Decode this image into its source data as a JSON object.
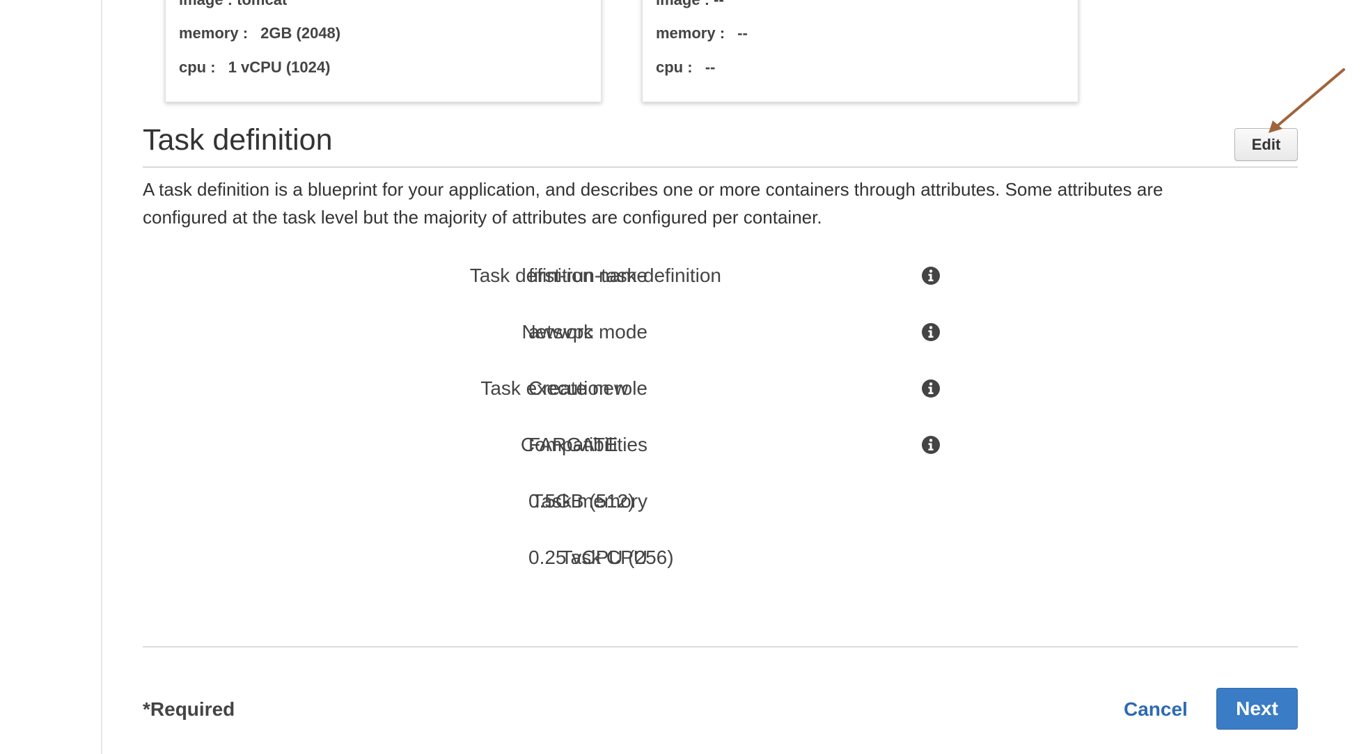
{
  "container_cards": [
    {
      "image_label": "image :",
      "image_value": "tomcat",
      "memory_label": "memory :",
      "memory_value": "2GB (2048)",
      "cpu_label": "cpu :",
      "cpu_value": "1 vCPU (1024)"
    },
    {
      "image_label": "image :",
      "image_value": "--",
      "memory_label": "memory :",
      "memory_value": "--",
      "cpu_label": "cpu :",
      "cpu_value": "--"
    }
  ],
  "task_definition": {
    "title": "Task definition",
    "edit_label": "Edit",
    "description": "A task definition is a blueprint for your application, and describes one or more containers through attributes. Some attributes are configured at the task level but the majority of attributes are configured per container.",
    "fields": [
      {
        "label": "Task definition name",
        "value": "first-run-task-definition",
        "has_info": true
      },
      {
        "label": "Network mode",
        "value": "awsvpc",
        "has_info": true
      },
      {
        "label": "Task execution role",
        "value": "Create new",
        "has_info": true
      },
      {
        "label": "Compatibilities",
        "value": "FARGATE",
        "has_info": true
      },
      {
        "label": "Task memory",
        "value": "0.5GB (512)",
        "has_info": false
      },
      {
        "label": "Task CPU",
        "value": "0.25 vCPU (256)",
        "has_info": false
      }
    ]
  },
  "footer": {
    "required_note": "*Required",
    "cancel_label": "Cancel",
    "next_label": "Next"
  },
  "colors": {
    "primary_button": "#3a7cc5",
    "link": "#2d6ab3",
    "annotation_arrow": "#a0643c"
  },
  "icons": {
    "info": "info-icon",
    "annotation": "arrow-annotation-icon"
  }
}
